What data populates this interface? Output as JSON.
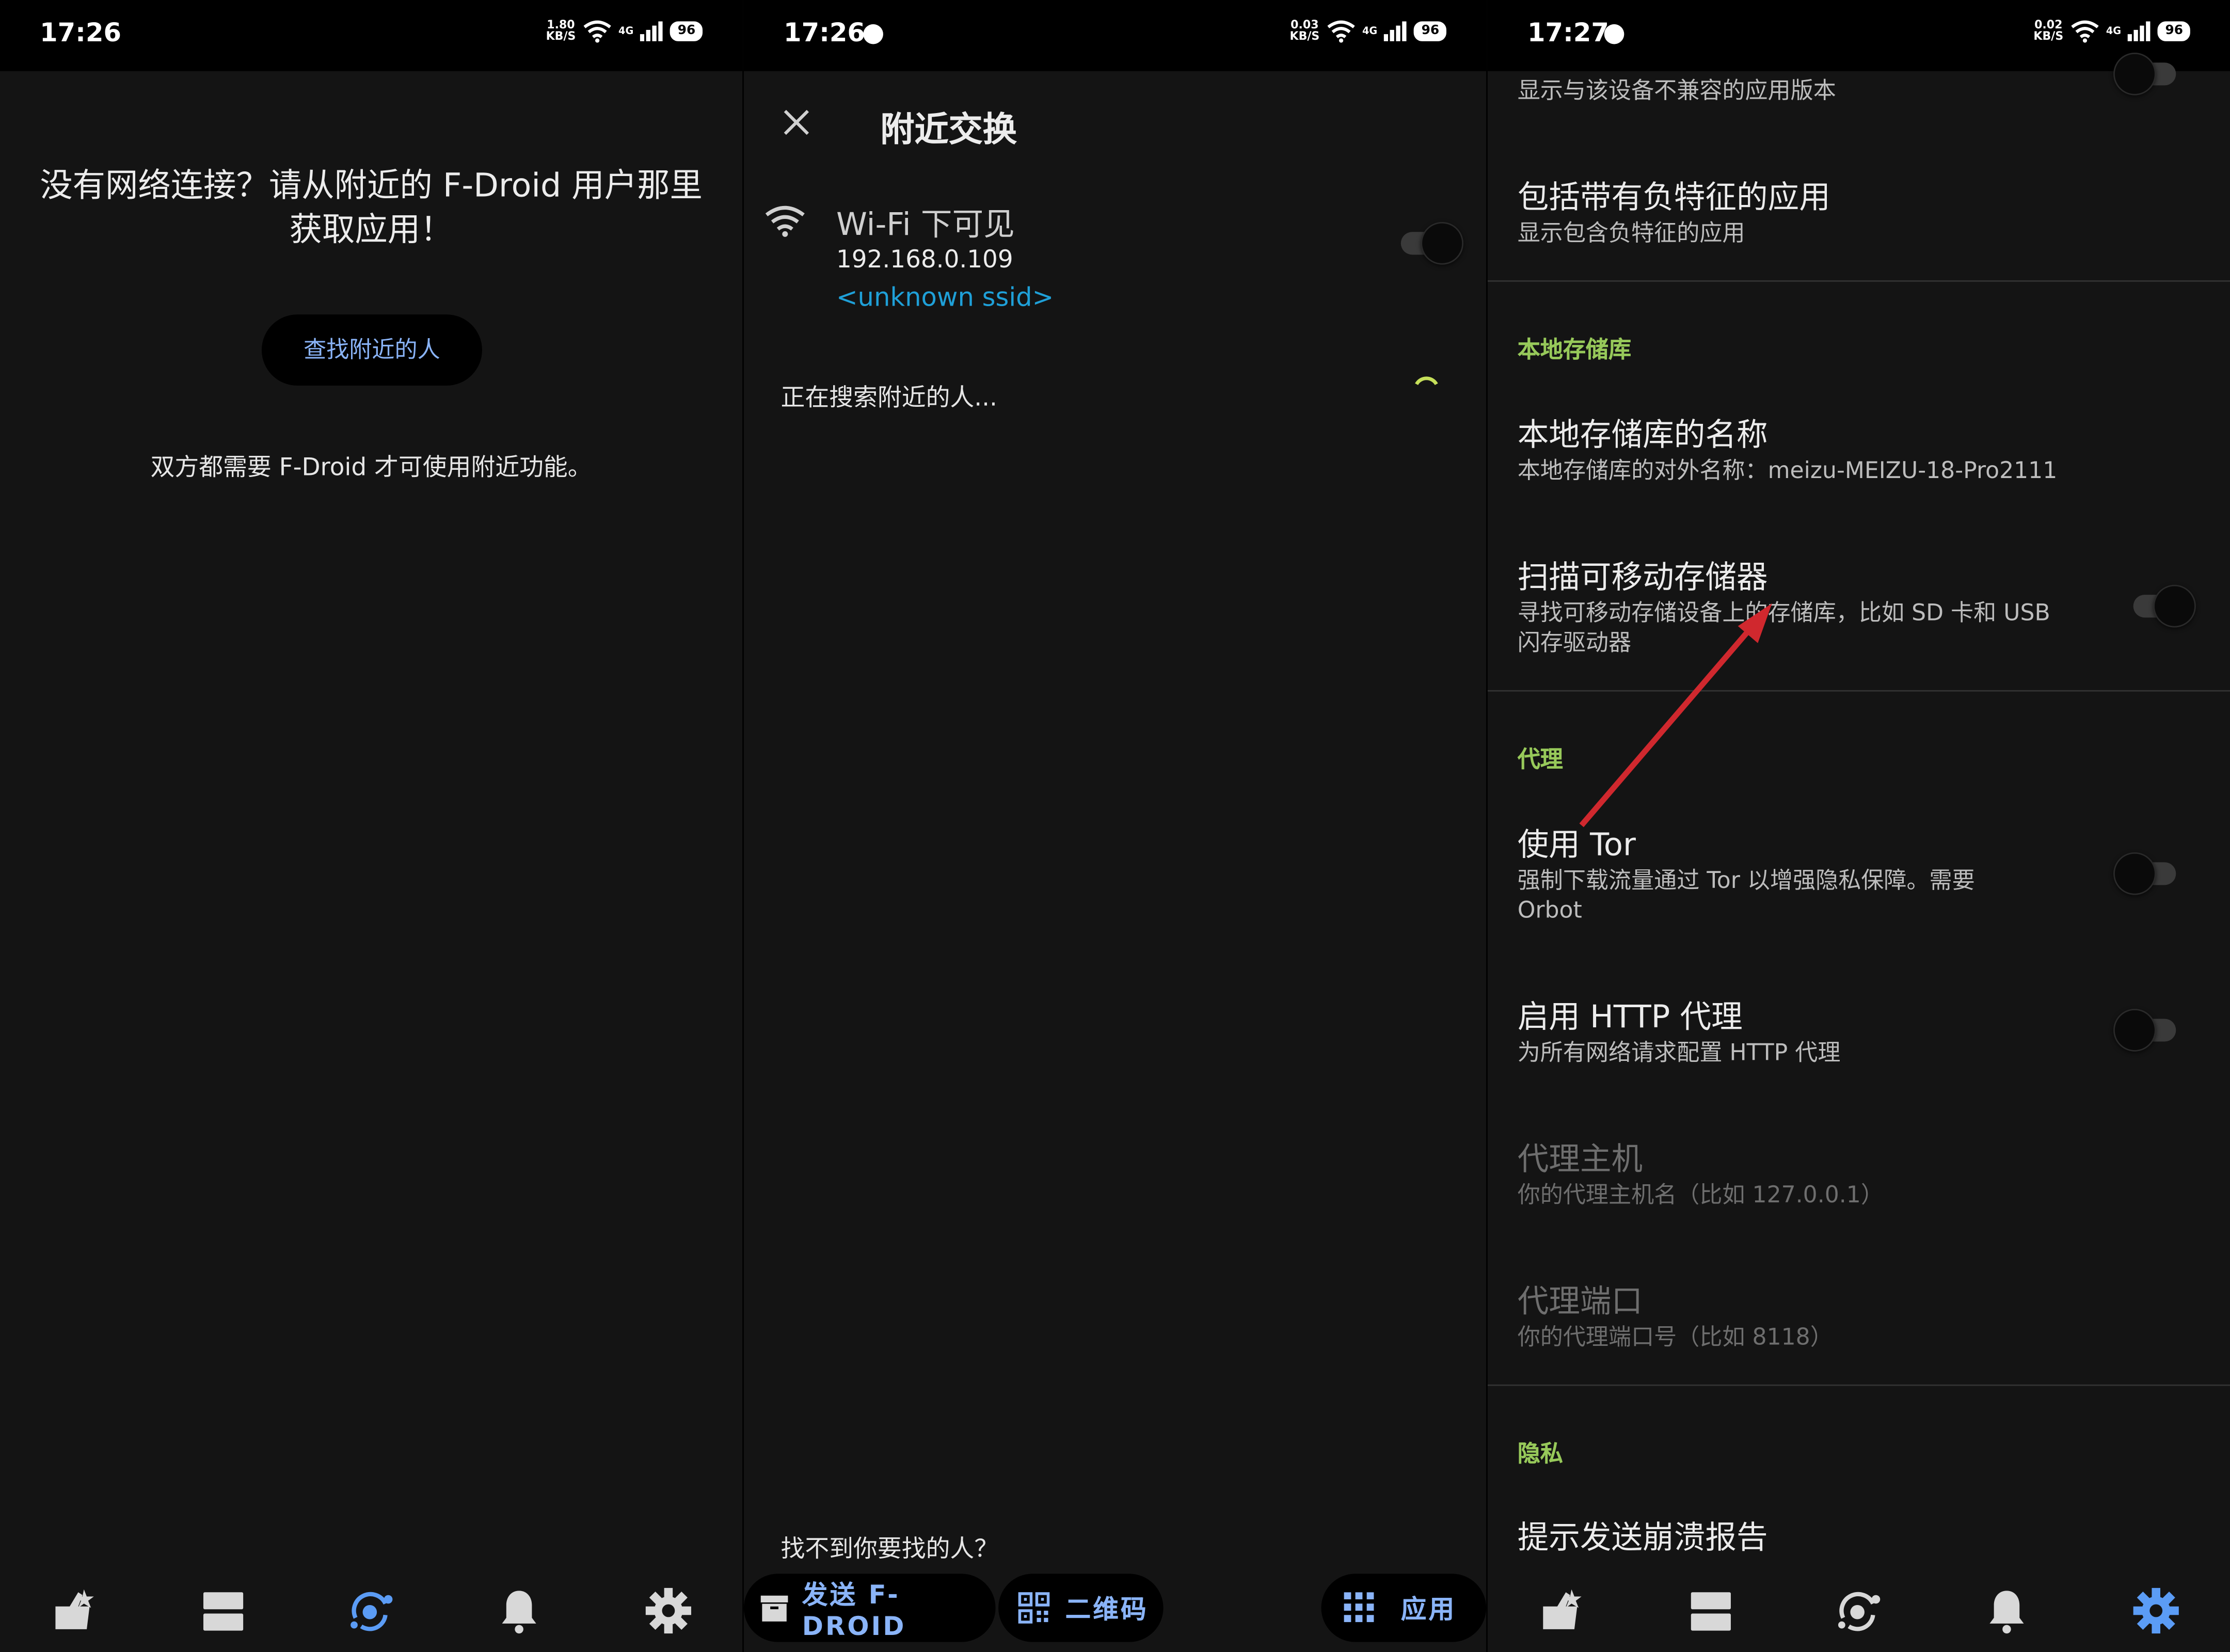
{
  "colors": {
    "accent_blue": "#8ab4f8",
    "active_nav": "#5b9cf5",
    "section_green": "#97c95a",
    "ssid_blue": "#1fa0d8",
    "arrow_red": "#d0282e"
  },
  "panel1": {
    "status": {
      "time": "17:26",
      "net_speed": "1.80",
      "net_unit": "KB/S",
      "signal": "4G",
      "battery": "96"
    },
    "title": "没有网络连接？请从附近的 F-Droid 用户那里获取应用！",
    "find_button": "查找附近的人",
    "note": "双方都需要 F-Droid 才可使用附近功能。",
    "nav": [
      {
        "label": "最新",
        "icon": "latest-icon",
        "active": false
      },
      {
        "label": "类别",
        "icon": "categories-icon",
        "active": false
      },
      {
        "label": "附近",
        "icon": "nearby-icon",
        "active": true
      },
      {
        "label": "更新",
        "icon": "bell-icon",
        "active": false
      },
      {
        "label": "设置",
        "icon": "gear-icon",
        "active": false
      }
    ]
  },
  "panel2": {
    "status": {
      "time": "17:26",
      "net_speed": "0.03",
      "net_unit": "KB/S",
      "signal": "4G",
      "battery": "96"
    },
    "title": "附近交换",
    "wifi_title": "Wi-Fi 下可见",
    "ip": "192.168.0.109",
    "ssid": "<unknown ssid>",
    "searching": "正在搜索附近的人...",
    "cant_find": "找不到你要找的人？",
    "send_button": "发送 F-DROID",
    "qr_button": "二维码",
    "apps_button": "应用",
    "wifi_toggle_on": false
  },
  "panel3": {
    "status": {
      "time": "17:27",
      "net_speed": "0.02",
      "net_unit": "KB/S",
      "signal": "4G",
      "battery": "96"
    },
    "top_sub": "显示与该设备不兼容的应用版本",
    "anti_features": {
      "title": "包括带有负特征的应用",
      "sub": "显示包含负特征的应用"
    },
    "section_local_repo": "本地存储库",
    "local_repo_name": {
      "title": "本地存储库的名称",
      "sub": "本地存储库的对外名称：meizu-MEIZU-18-Pro2111"
    },
    "scan_removable": {
      "title": "扫描可移动存储器",
      "sub": "寻找可移动存储设备上的存储库，比如 SD 卡和 USB 闪存驱动器",
      "on": false
    },
    "section_proxy": "代理",
    "use_tor": {
      "title": "使用 Tor",
      "sub": "强制下载流量通过 Tor 以增强隐私保障。需要 Orbot",
      "on": false
    },
    "http_proxy": {
      "title": "启用 HTTP 代理",
      "sub": "为所有网络请求配置 HTTP 代理",
      "on": false
    },
    "proxy_host": {
      "title": "代理主机",
      "sub": "你的代理主机名（比如 127.0.0.1）"
    },
    "proxy_port": {
      "title": "代理端口",
      "sub": "你的代理端口号（比如 8118）"
    },
    "section_privacy": "隐私",
    "crash_report": {
      "title": "提示发送崩溃报告"
    },
    "nav": [
      {
        "label": "最新",
        "icon": "latest-icon",
        "active": false
      },
      {
        "label": "类别",
        "icon": "categories-icon",
        "active": false
      },
      {
        "label": "附近",
        "icon": "nearby-icon",
        "active": false
      },
      {
        "label": "更新",
        "icon": "bell-icon",
        "active": false
      },
      {
        "label": "设置",
        "icon": "gear-icon",
        "active": true
      }
    ]
  }
}
